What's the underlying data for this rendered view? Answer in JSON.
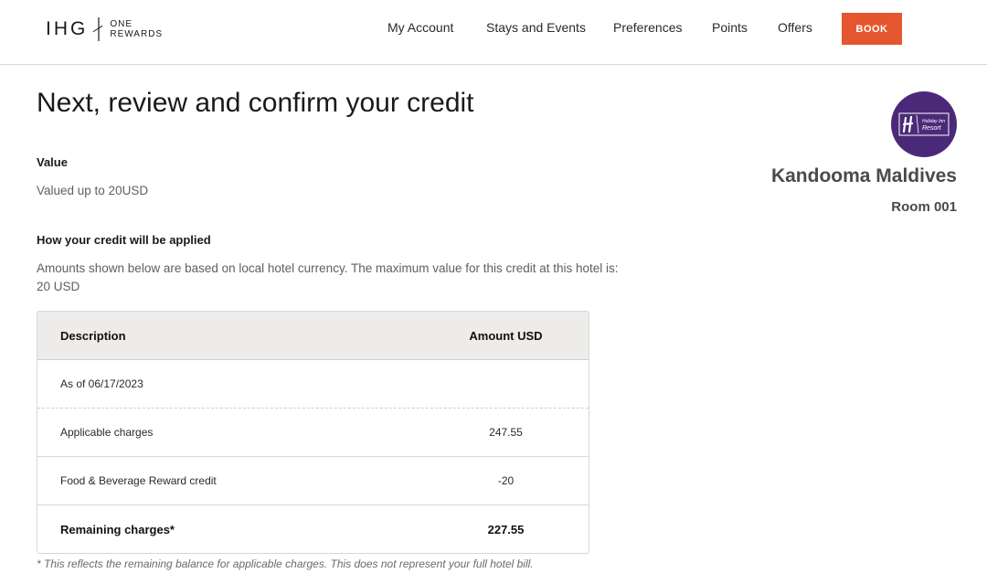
{
  "header": {
    "logo": {
      "brand": "IHG",
      "program_line1": "ONE",
      "program_line2": "REWARDS"
    },
    "nav": [
      {
        "label": "My Account"
      },
      {
        "label": "Stays and Events"
      },
      {
        "label": "Preferences"
      },
      {
        "label": "Points"
      },
      {
        "label": "Offers"
      }
    ],
    "book_label": "BOOK"
  },
  "main": {
    "title": "Next, review and confirm your credit",
    "value_label": "Value",
    "value_text": "Valued up to 20USD",
    "applied_label": "How your credit will be applied",
    "applied_text": "Amounts shown below are based on local hotel currency. The maximum value for this credit at this hotel is: 20 USD",
    "table": {
      "headers": {
        "description": "Description",
        "amount": "Amount USD"
      },
      "as_of": "As of 06/17/2023",
      "rows": [
        {
          "description": "Applicable charges",
          "amount": "247.55"
        },
        {
          "description": "Food & Beverage Reward credit",
          "amount": "-20"
        }
      ],
      "total": {
        "description": "Remaining charges*",
        "amount": "227.55"
      }
    },
    "footnote": "* This reflects the remaining balance for applicable charges. This does not represent your full hotel bill."
  },
  "hotel": {
    "badge_icon": "holiday-inn-resort-logo",
    "badge_text": "Holiday Inn Resort",
    "name": "Kandooma Maldives",
    "room": "Room 001"
  },
  "colors": {
    "accent": "#e4572e",
    "brand_purple": "#4a2a78",
    "table_header_bg": "#eeecea"
  }
}
